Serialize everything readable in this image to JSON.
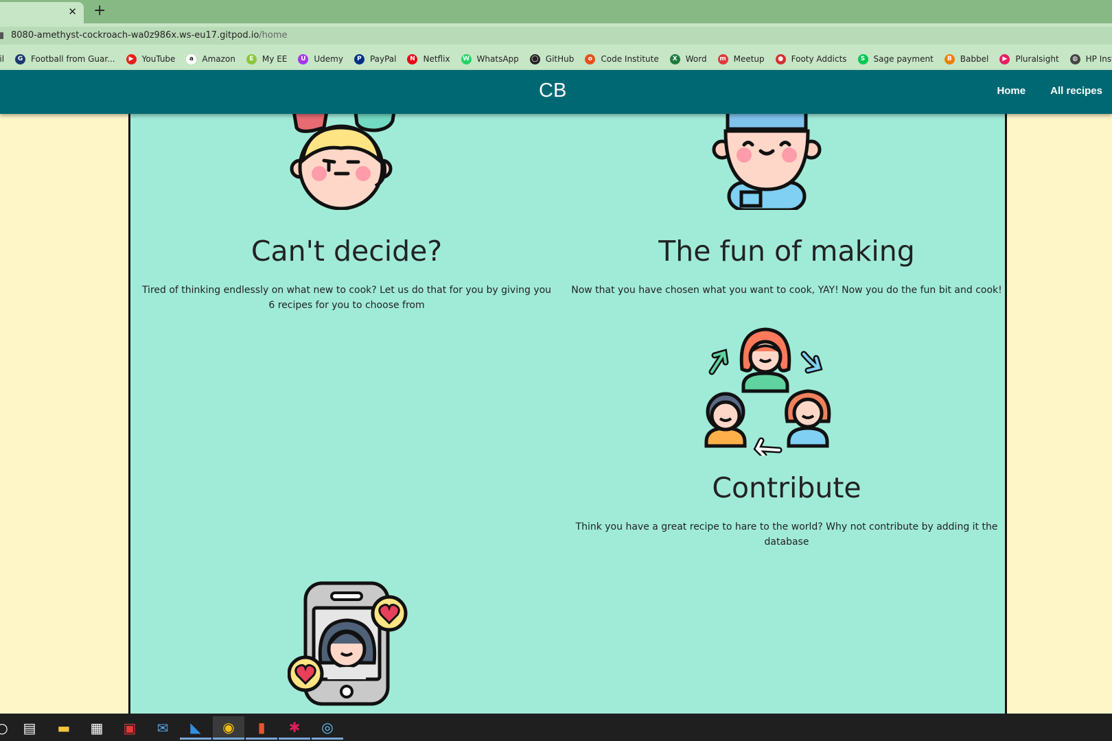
{
  "browser": {
    "tab_close": "✕",
    "new_tab": "+",
    "url_host": "8080-amethyst-cockroach-wa0z986x.ws-eu17.gitpod.io",
    "url_path": "/home",
    "bookmark_first": "ail",
    "bookmarks": [
      {
        "label": "Football from Guar...",
        "icon": "guardian-icon",
        "color": "#1b3a6b",
        "glyph": "G"
      },
      {
        "label": "YouTube",
        "icon": "youtube-icon",
        "color": "#e62117",
        "glyph": "▶"
      },
      {
        "label": "Amazon",
        "icon": "amazon-icon",
        "color": "#ffffff",
        "glyph": "a"
      },
      {
        "label": "My EE",
        "icon": "ee-icon",
        "color": "#8cc63f",
        "glyph": "E"
      },
      {
        "label": "Udemy",
        "icon": "udemy-icon",
        "color": "#a435f0",
        "glyph": "U"
      },
      {
        "label": "PayPal",
        "icon": "paypal-icon",
        "color": "#003087",
        "glyph": "P"
      },
      {
        "label": "Netflix",
        "icon": "netflix-icon",
        "color": "#e50914",
        "glyph": "N"
      },
      {
        "label": "WhatsApp",
        "icon": "whatsapp-icon",
        "color": "#25d366",
        "glyph": "W"
      },
      {
        "label": "GitHub",
        "icon": "github-icon",
        "color": "#222222",
        "glyph": "◯"
      },
      {
        "label": "Code Institute",
        "icon": "code-institute-icon",
        "color": "#e84e1b",
        "glyph": "o"
      },
      {
        "label": "Word",
        "icon": "word-icon",
        "color": "#1f7a3f",
        "glyph": "X"
      },
      {
        "label": "Meetup",
        "icon": "meetup-icon",
        "color": "#e0393e",
        "glyph": "m"
      },
      {
        "label": "Footy Addicts",
        "icon": "footy-addicts-icon",
        "color": "#d32f2f",
        "glyph": "●"
      },
      {
        "label": "Sage payment",
        "icon": "sage-icon",
        "color": "#00c853",
        "glyph": "S"
      },
      {
        "label": "Babbel",
        "icon": "babbel-icon",
        "color": "#f57c00",
        "glyph": "B"
      },
      {
        "label": "Pluralsight",
        "icon": "pluralsight-icon",
        "color": "#e91e63",
        "glyph": "▶"
      },
      {
        "label": "HP Instant Ink",
        "icon": "hp-icon",
        "color": "#444444",
        "glyph": "◍"
      }
    ]
  },
  "nav": {
    "brand": "CB",
    "links": [
      "Home",
      "All recipes"
    ]
  },
  "features": [
    {
      "title": "Can't decide?",
      "text": "Tired of thinking endlessly on what new to cook? Let us do that for you by giving you 6 recipes for you to choose from"
    },
    {
      "title": "The fun of making",
      "text": "Now that you have chosen what you want to cook, YAY! Now you do the fun bit and cook!"
    },
    {
      "title": "Contribute",
      "text": "Think you have a great recipe to hare to the world? Why not contribute by adding it the database"
    }
  ],
  "colors": {
    "nav_bg": "#006873",
    "content_bg": "#a0ebd8",
    "page_bg": "#fff6c8",
    "tabstrip_bg": "#86b984"
  },
  "taskbar": [
    "search-icon",
    "task-view-icon",
    "file-explorer-icon",
    "store-icon",
    "gift-icon",
    "mail-icon",
    "vscode-icon",
    "chrome-icon",
    "office-icon",
    "slack-icon",
    "steam-icon"
  ]
}
